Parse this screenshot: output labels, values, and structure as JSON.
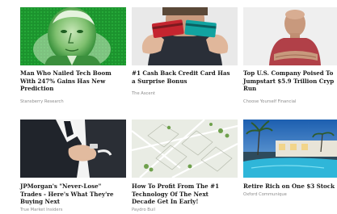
{
  "sponsored_grid": {
    "cards": [
      {
        "thumbnail_icon": "money-bill-face-image",
        "headline_lines": [
          "Man Who Nailed Tech Boom",
          "With 247% Gains Has New",
          "Prediction"
        ],
        "source": "Stansberry Research"
      },
      {
        "thumbnail_icon": "hands-holding-credit-cards-image",
        "headline_lines": [
          "#1 Cash Back Credit Card Has",
          "a Surprise Bonus"
        ],
        "source": "The Ascent"
      },
      {
        "thumbnail_icon": "bald-man-arms-crossed-image",
        "headline_lines": [
          "Top U.S. Company Poised To",
          "Jumpstart $5.9 Trillion Cryp",
          "Run"
        ],
        "source": "Choose Yourself Financial"
      },
      {
        "thumbnail_icon": "businessman-handshake-image",
        "headline_lines": [
          "JPMorgan's \"Never-Lose\"",
          "Trades - Here's What They're",
          "Buying Next"
        ],
        "source": "True Market Insiders"
      },
      {
        "thumbnail_icon": "aerial-land-plots-image",
        "headline_lines": [
          "How To Profit From The #1",
          "Technology Of The Next",
          "Decade Get In Early!"
        ],
        "source": "Paydro Buil"
      },
      {
        "thumbnail_icon": "luxury-pool-house-image",
        "headline_lines": [
          "Retire Rich on One $3 Stock"
        ],
        "source": "Oxford Communique"
      }
    ]
  }
}
